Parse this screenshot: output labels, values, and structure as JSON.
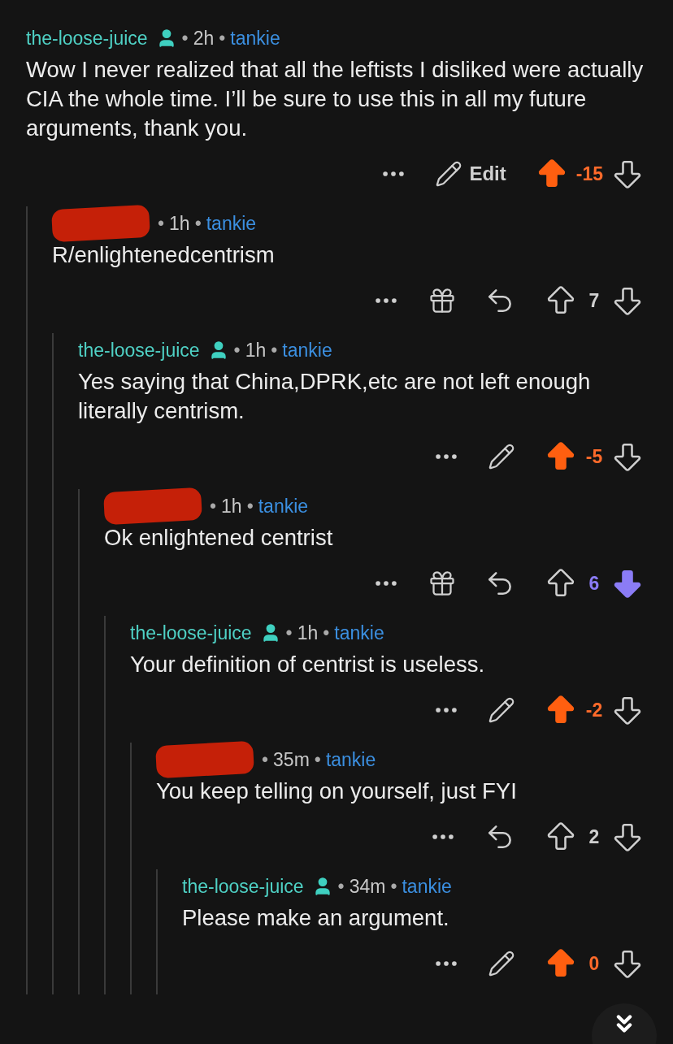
{
  "separator": "•",
  "thread": {
    "author": {
      "kind": "self",
      "name": "the-loose-juice"
    },
    "time": "2h",
    "flair": "tankie",
    "body": "Wow I never realized that all the leftists I disliked were actually CIA the whole time. I’ll be sure to use this in all my future arguments, thank you.",
    "actions": [
      {
        "kind": "more"
      },
      {
        "kind": "edit",
        "label": "Edit"
      }
    ],
    "upvoted": true,
    "downvoted": false,
    "score": "-15",
    "replies": [
      {
        "author": {
          "kind": "redacted"
        },
        "time": "1h",
        "flair": "tankie",
        "body": "R/enlightenedcentrism",
        "actions": [
          {
            "kind": "more"
          },
          {
            "kind": "award"
          },
          {
            "kind": "reply"
          }
        ],
        "upvoted": false,
        "downvoted": false,
        "score": "7",
        "replies": [
          {
            "author": {
              "kind": "self",
              "name": "the-loose-juice"
            },
            "time": "1h",
            "flair": "tankie",
            "body": "Yes saying that China,DPRK,etc are not left enough literally centrism.",
            "actions": [
              {
                "kind": "more"
              },
              {
                "kind": "edit"
              }
            ],
            "upvoted": true,
            "downvoted": false,
            "score": "-5",
            "replies": [
              {
                "author": {
                  "kind": "redacted"
                },
                "time": "1h",
                "flair": "tankie",
                "body": "Ok enlightened centrist",
                "actions": [
                  {
                    "kind": "more"
                  },
                  {
                    "kind": "award"
                  },
                  {
                    "kind": "reply"
                  }
                ],
                "upvoted": false,
                "downvoted": true,
                "score": "6",
                "replies": [
                  {
                    "author": {
                      "kind": "self",
                      "name": "the-loose-juice"
                    },
                    "time": "1h",
                    "flair": "tankie",
                    "body": "Your definition of centrist is useless.",
                    "actions": [
                      {
                        "kind": "more"
                      },
                      {
                        "kind": "edit"
                      }
                    ],
                    "upvoted": true,
                    "downvoted": false,
                    "score": "-2",
                    "replies": [
                      {
                        "author": {
                          "kind": "redacted"
                        },
                        "time": "35m",
                        "flair": "tankie",
                        "body": "You keep telling on yourself, just FYI",
                        "actions": [
                          {
                            "kind": "more"
                          },
                          {
                            "kind": "reply"
                          }
                        ],
                        "upvoted": false,
                        "downvoted": false,
                        "score": "2",
                        "replies": [
                          {
                            "author": {
                              "kind": "self",
                              "name": "the-loose-juice"
                            },
                            "time": "34m",
                            "flair": "tankie",
                            "body": "Please make an argument.",
                            "actions": [
                              {
                                "kind": "more"
                              },
                              {
                                "kind": "edit"
                              }
                            ],
                            "upvoted": true,
                            "downvoted": false,
                            "score": "0"
                          }
                        ]
                      }
                    ]
                  }
                ]
              }
            ]
          }
        ]
      }
    ]
  }
}
